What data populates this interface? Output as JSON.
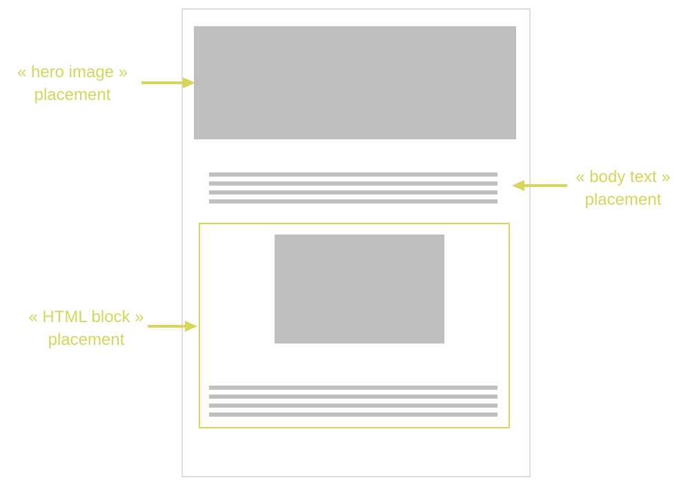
{
  "callouts": {
    "hero": {
      "line1": "« hero image »",
      "line2": "placement"
    },
    "body": {
      "line1": "« body text »",
      "line2": "placement"
    },
    "html": {
      "line1": "« HTML block »",
      "line2": "placement"
    }
  },
  "colors": {
    "accent": "#d6d65a",
    "placeholder": "#bfbfbf",
    "frame_border": "#dcdcdc"
  }
}
